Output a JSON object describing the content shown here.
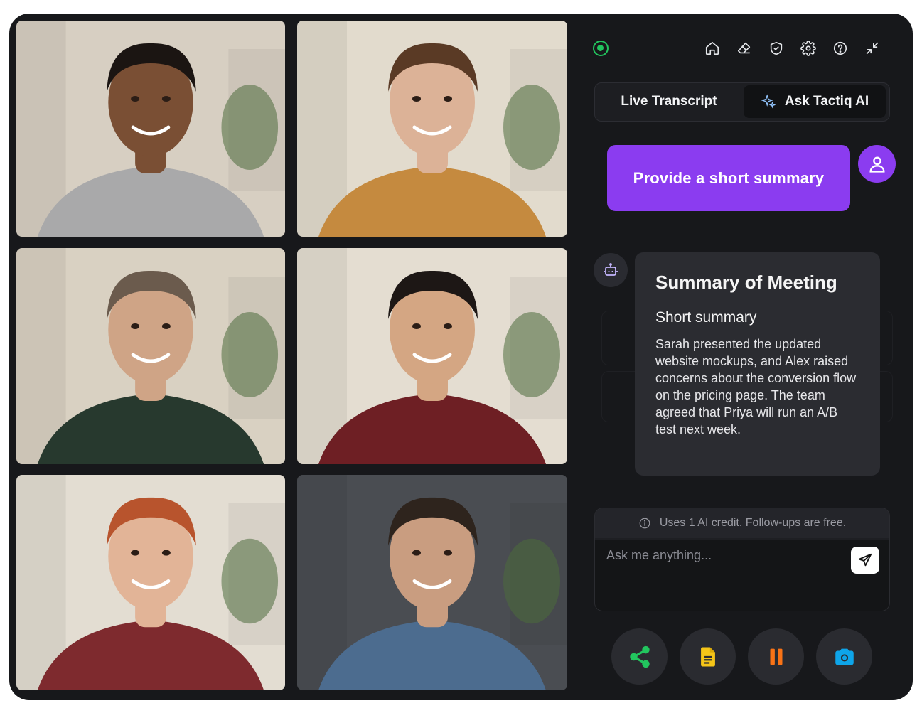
{
  "videos": [
    {
      "participant": "man-beard-grey-sweater",
      "colors": {
        "bg": "#d7cfc2",
        "skin": "#7a4f34",
        "hair": "#1b1512",
        "shirt": "#a9a9aa"
      }
    },
    {
      "participant": "woman-mustard-sweater",
      "colors": {
        "bg": "#e2dbcd",
        "skin": "#dcb297",
        "hair": "#5a3a25",
        "shirt": "#c58a3f"
      }
    },
    {
      "participant": "man-green-sweater",
      "colors": {
        "bg": "#d9d1c2",
        "skin": "#cfa486",
        "hair": "#6b5b4d",
        "shirt": "#27392e"
      }
    },
    {
      "participant": "woman-red-sweater",
      "colors": {
        "bg": "#e4ddd1",
        "skin": "#d4a683",
        "hair": "#1d1715",
        "shirt": "#6e1f24"
      }
    },
    {
      "participant": "man-red-hair",
      "colors": {
        "bg": "#e3ddd2",
        "skin": "#e2b497",
        "hair": "#b8542d",
        "shirt": "#7e2a2e"
      }
    },
    {
      "participant": "man-denim-shirt",
      "colors": {
        "bg": "#4a4d52",
        "skin": "#c99d80",
        "hair": "#2e241d",
        "shirt": "#4c6c8f"
      }
    }
  ],
  "header": {
    "status_color": "#22c55e",
    "icons": [
      "home-icon",
      "eraser-icon",
      "shield-icon",
      "settings-icon",
      "help-icon",
      "minimize-icon"
    ]
  },
  "tabs": {
    "live_transcript": "Live Transcript",
    "ask_ai": "Ask Tactiq AI"
  },
  "chat": {
    "user_message": "Provide a short summary",
    "summary_title": "Summary of Meeting",
    "summary_subtitle": "Short summary",
    "summary_text": "Sarah presented the updated website mockups, and Alex raised concerns about the conversion flow on the pricing page. The team agreed that Priya will run an A/B test next week."
  },
  "composer": {
    "credit_note": "Uses 1 AI credit. Follow-ups are free.",
    "placeholder": "Ask me anything..."
  },
  "actions": {
    "share_color": "#22c55e",
    "doc_color": "#f5c518",
    "pause_color": "#f97316",
    "camera_color": "#0ea5e9"
  },
  "accent": "#8b3cf0"
}
